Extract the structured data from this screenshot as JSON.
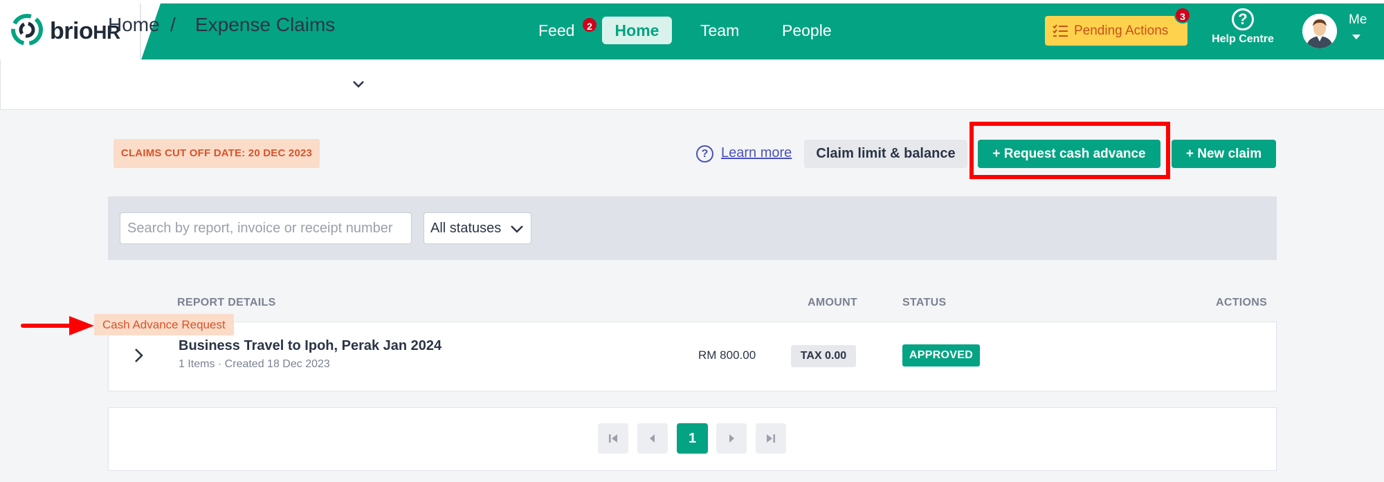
{
  "brand": {
    "name": "brio",
    "suffix": "HR",
    "color": "#04a383"
  },
  "nav": {
    "items": [
      {
        "label": "Feed",
        "badge": "2"
      },
      {
        "label": "Home",
        "active": true
      },
      {
        "label": "Team"
      },
      {
        "label": "People"
      }
    ],
    "pending_label": "Pending Actions",
    "pending_badge": "3",
    "help_label": "Help Centre",
    "me_label": "Me"
  },
  "breadcrumb": {
    "home": "Home",
    "separator": "/",
    "current": "Expense Claims"
  },
  "actions": {
    "cutoff": "CLAIMS CUT OFF DATE: 20 DEC 2023",
    "learn_more": "Learn more",
    "claim_limit": "Claim limit & balance",
    "request_advance": "+ Request cash advance",
    "new_claim": "+ New claim"
  },
  "filters": {
    "search_placeholder": "Search by report, invoice or receipt number",
    "status_value": "All statuses"
  },
  "table": {
    "headers": {
      "report": "REPORT DETAILS",
      "amount": "AMOUNT",
      "status": "STATUS",
      "actions": "ACTIONS"
    },
    "rows": [
      {
        "tag": "Cash Advance Request",
        "title": "Business Travel to Ipoh, Perak Jan 2024",
        "subtitle": "1 Items · Created 18 Dec 2023",
        "amount": "RM 800.00",
        "tax": "TAX 0.00",
        "status": "APPROVED"
      }
    ]
  },
  "pagination": {
    "current": "1"
  },
  "icons": [
    "brio-logo-icon",
    "pending-list-icon",
    "help-icon",
    "avatar",
    "chevron-down-icon",
    "question-icon",
    "chevron-right-icon",
    "first-page-icon",
    "prev-page-icon",
    "next-page-icon",
    "last-page-icon",
    "red-arrow-icon"
  ]
}
